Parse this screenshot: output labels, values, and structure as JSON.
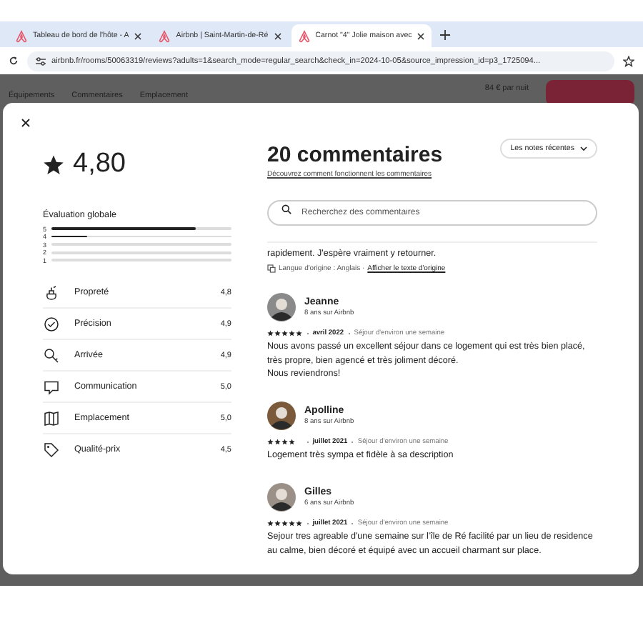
{
  "browser": {
    "tabs": [
      {
        "title": "Tableau de bord de l'hôte - A",
        "selected": false
      },
      {
        "title": "Airbnb | Saint-Martin-de-Ré",
        "selected": false
      },
      {
        "title": "Carnot \"4\" Jolie maison avec",
        "selected": true
      }
    ],
    "url": "airbnb.fr/rooms/50063319/reviews?adults=1&search_mode=regular_search&check_in=2024-10-05&source_impression_id=p3_1725094..."
  },
  "page": {
    "nav": [
      "Équipements",
      "Commentaires",
      "Emplacement"
    ],
    "price": "84 € par nuit"
  },
  "summary": {
    "rating": "4,80",
    "overall_label": "Évaluation globale",
    "histogram": [
      {
        "label": "5",
        "level": 0.8
      },
      {
        "label": "4",
        "level": 0.2
      },
      {
        "label": "3",
        "level": 0
      },
      {
        "label": "2",
        "level": 0
      },
      {
        "label": "1",
        "level": 0
      }
    ],
    "categories": [
      {
        "name": "Propreté",
        "score": "4,8"
      },
      {
        "name": "Précision",
        "score": "4,9"
      },
      {
        "name": "Arrivée",
        "score": "4,9"
      },
      {
        "name": "Communication",
        "score": "5,0"
      },
      {
        "name": "Emplacement",
        "score": "5,0"
      },
      {
        "name": "Qualité-prix",
        "score": "4,5"
      }
    ]
  },
  "reviews_panel": {
    "title": "20 commentaires",
    "help_link": "Découvrez comment fonctionnent les commentaires",
    "sort": "Les notes récentes",
    "search": {
      "placeholder": "Recherchez des commentaires"
    },
    "partial_review": {
      "text": "rapidement. J'espère vraiment y retourner.",
      "language": "Langue d'origine : Anglais ·",
      "translate_link": "Afficher le texte d'origine"
    },
    "reviews": [
      {
        "name": "Jeanne",
        "tenure": "8 ans sur Airbnb",
        "stars": 5,
        "date": "avril 2022",
        "stay": "Séjour d'environ une semaine",
        "text": "Nous avons passé un excellent séjour dans ce logement qui est très bien placé, très propre, bien agencé et très joliment décoré.\nNous reviendrons!"
      },
      {
        "name": "Apolline",
        "tenure": "8 ans sur Airbnb",
        "stars": 4,
        "date": "juillet 2021",
        "stay": "Séjour d'environ une semaine",
        "text": "Logement très sympa et fidèle à sa description"
      },
      {
        "name": "Gilles",
        "tenure": "6 ans sur Airbnb",
        "stars": 5,
        "date": "juillet 2021",
        "stay": "Séjour d'environ une semaine",
        "text": "Sejour tres agreable d'une semaine sur l'île de Ré facilité par un lieu de residence au calme, bien décoré et équipé avec un accueil charmant sur place."
      }
    ]
  }
}
